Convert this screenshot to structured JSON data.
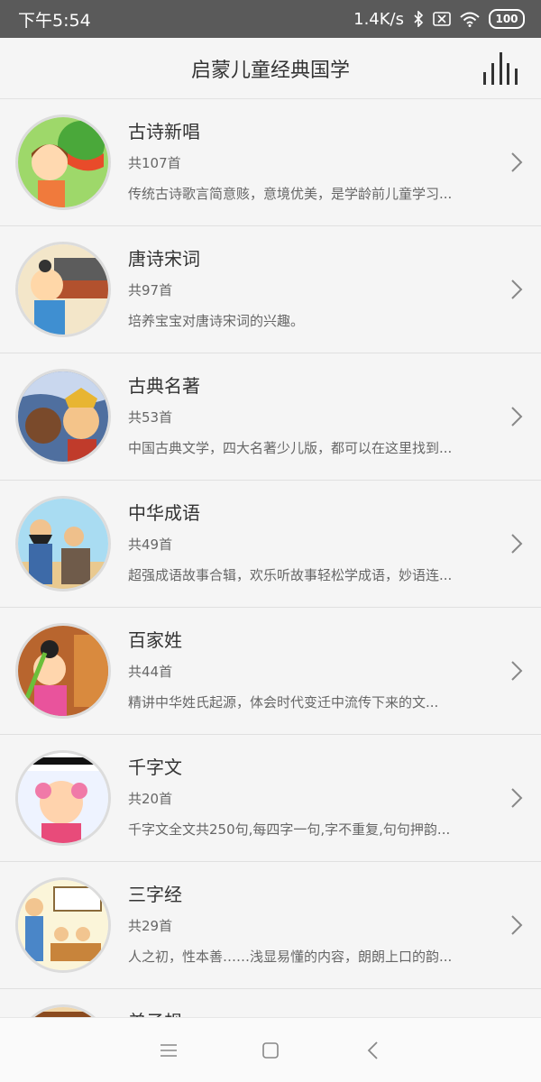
{
  "status_bar": {
    "time": "下午5:54",
    "network_speed": "1.4K/s",
    "battery": "100"
  },
  "header": {
    "title": "启蒙儿童经典国学"
  },
  "items": [
    {
      "name": "古诗新唱",
      "count": "共107首",
      "desc": "传统古诗歌言简意赅，意境优美，是学龄前儿童学习..."
    },
    {
      "name": "唐诗宋词",
      "count": "共97首",
      "desc": "培养宝宝对唐诗宋词的兴趣。"
    },
    {
      "name": "古典名著",
      "count": "共53首",
      "desc": "中国古典文学，四大名著少儿版，都可以在这里找到..."
    },
    {
      "name": "中华成语",
      "count": "共49首",
      "desc": "超强成语故事合辑，欢乐听故事轻松学成语，妙语连..."
    },
    {
      "name": "百家姓",
      "count": "共44首",
      "desc": "精讲中华姓氏起源，体会时代变迁中流传下来的文..."
    },
    {
      "name": "千字文",
      "count": "共20首",
      "desc": "千字文全文共250句,每四字一句,字不重复,句句押韵..."
    },
    {
      "name": "三字经",
      "count": "共29首",
      "desc": "人之初，性本善……浅显易懂的内容，朗朗上口的韵..."
    },
    {
      "name": "弟子规",
      "count": "",
      "desc": ""
    }
  ]
}
